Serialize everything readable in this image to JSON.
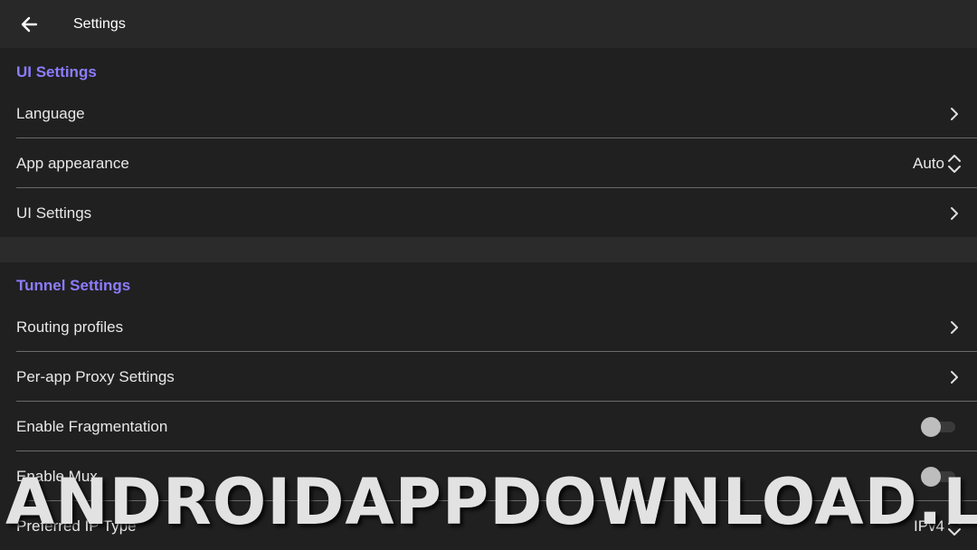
{
  "header": {
    "title": "Settings",
    "back_icon": "arrow-left-icon"
  },
  "sections": [
    {
      "title": "UI Settings",
      "rows": [
        {
          "label": "Language",
          "control": "chevron"
        },
        {
          "label": "App appearance",
          "control": "select",
          "value": "Auto"
        },
        {
          "label": "UI Settings",
          "control": "chevron"
        }
      ]
    },
    {
      "title": "Tunnel Settings",
      "rows": [
        {
          "label": "Routing profiles",
          "control": "chevron"
        },
        {
          "label": "Per-app Proxy Settings",
          "control": "chevron"
        },
        {
          "label": "Enable Fragmentation",
          "control": "toggle",
          "on": false
        },
        {
          "label": "Enable Mux",
          "control": "toggle",
          "on": false
        },
        {
          "label": "Preferred IP Type",
          "control": "select",
          "value": "IPv4"
        }
      ]
    }
  ],
  "watermark": "ANDROIDAPPDOWNLOAD.L",
  "colors": {
    "accent": "#8c7cff",
    "background": "#202020",
    "topbar": "#282828",
    "divider": "#6a6a6a"
  }
}
